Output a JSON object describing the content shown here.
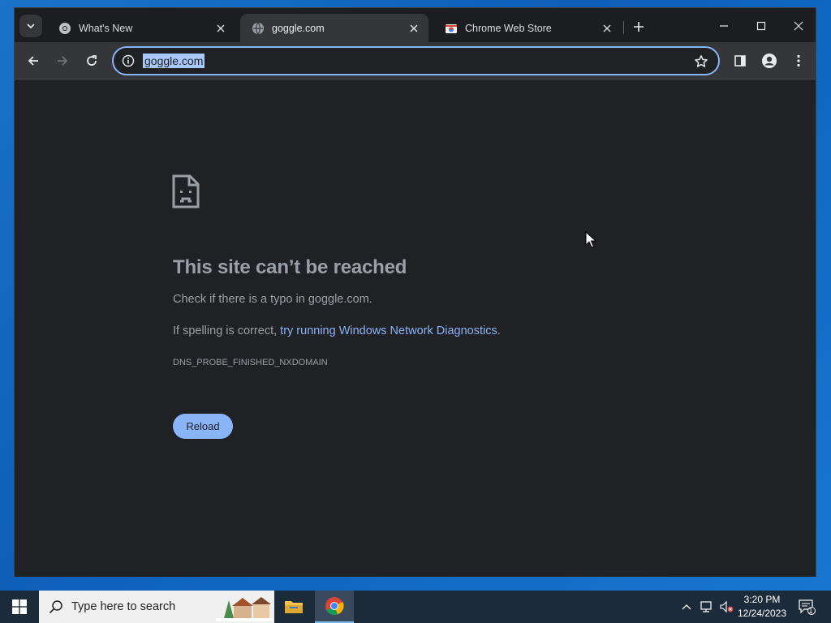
{
  "tabs": [
    {
      "title": "What's New",
      "active": false
    },
    {
      "title": "goggle.com",
      "active": true
    },
    {
      "title": "Chrome Web Store",
      "active": false
    }
  ],
  "omnibox": {
    "url": "goggle.com"
  },
  "error": {
    "title": "This site can’t be reached",
    "line1": "Check if there is a typo in goggle.com.",
    "line2_prefix": "If spelling is correct, ",
    "line2_link": "try running Windows Network Diagnostics",
    "line2_suffix": ".",
    "code": "DNS_PROBE_FINISHED_NXDOMAIN",
    "reload_label": "Reload"
  },
  "taskbar": {
    "search_placeholder": "Type here to search",
    "time": "3:20 PM",
    "date": "12/24/2023",
    "notification_count": "1"
  },
  "colors": {
    "accent": "#8ab4f8",
    "page_bg": "#202124",
    "toolbar_bg": "#35363a"
  },
  "icons": {
    "tab_search": "chevron-down-icon",
    "whats_new_tab": "chrome-logo-icon",
    "goggle_tab": "globe-icon",
    "web_store_tab": "web-store-icon",
    "error_page": "sad-document-icon"
  }
}
